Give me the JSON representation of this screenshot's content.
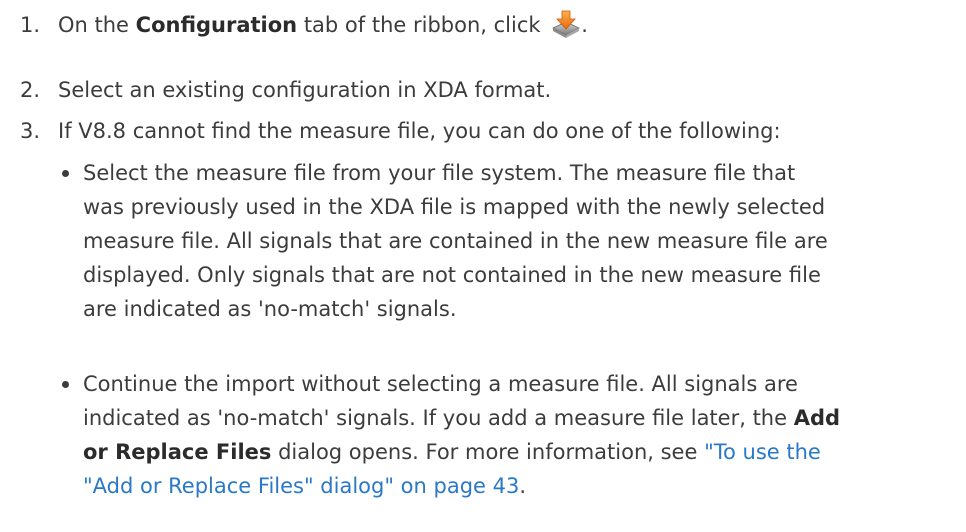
{
  "steps": [
    {
      "number": "1.",
      "text_before": "On the ",
      "bold_tab": "Configuration",
      "text_after": " tab of the ribbon, click ",
      "icon": "import-configuration-icon",
      "trailing": "."
    },
    {
      "number": "2.",
      "text": "Select an existing configuration in XDA format."
    },
    {
      "number": "3.",
      "text": "If V8.8 cannot find the measure file, you can do one of the following:",
      "bullets": [
        {
          "lines": [
            "Select the measure file from your file system. The measure file that",
            "was previously used in the XDA file is mapped with the newly selected",
            "measure file. All signals that are contained in the new measure file are",
            "displayed. Only signals that are not contained in the new measure file",
            "are indicated as 'no-match' signals."
          ]
        },
        {
          "line1": "Continue the import without selecting a measure file. All signals are",
          "line2_text": "indicated as 'no-match' signals. If you add a measure file later, the ",
          "line2_bold": "Add",
          "line3_bold": "or Replace Files",
          "line3_text": " dialog opens. For more information, see ",
          "line3_link": "\"To use the",
          "line4_link": "\"Add or Replace Files\" dialog\" on page 43",
          "line4_text": "."
        }
      ]
    }
  ],
  "colors": {
    "text": "#3c3c3c",
    "link": "#2a78c8",
    "icon_arrow": "#f08a24",
    "icon_tray": "#8a8a8a"
  }
}
